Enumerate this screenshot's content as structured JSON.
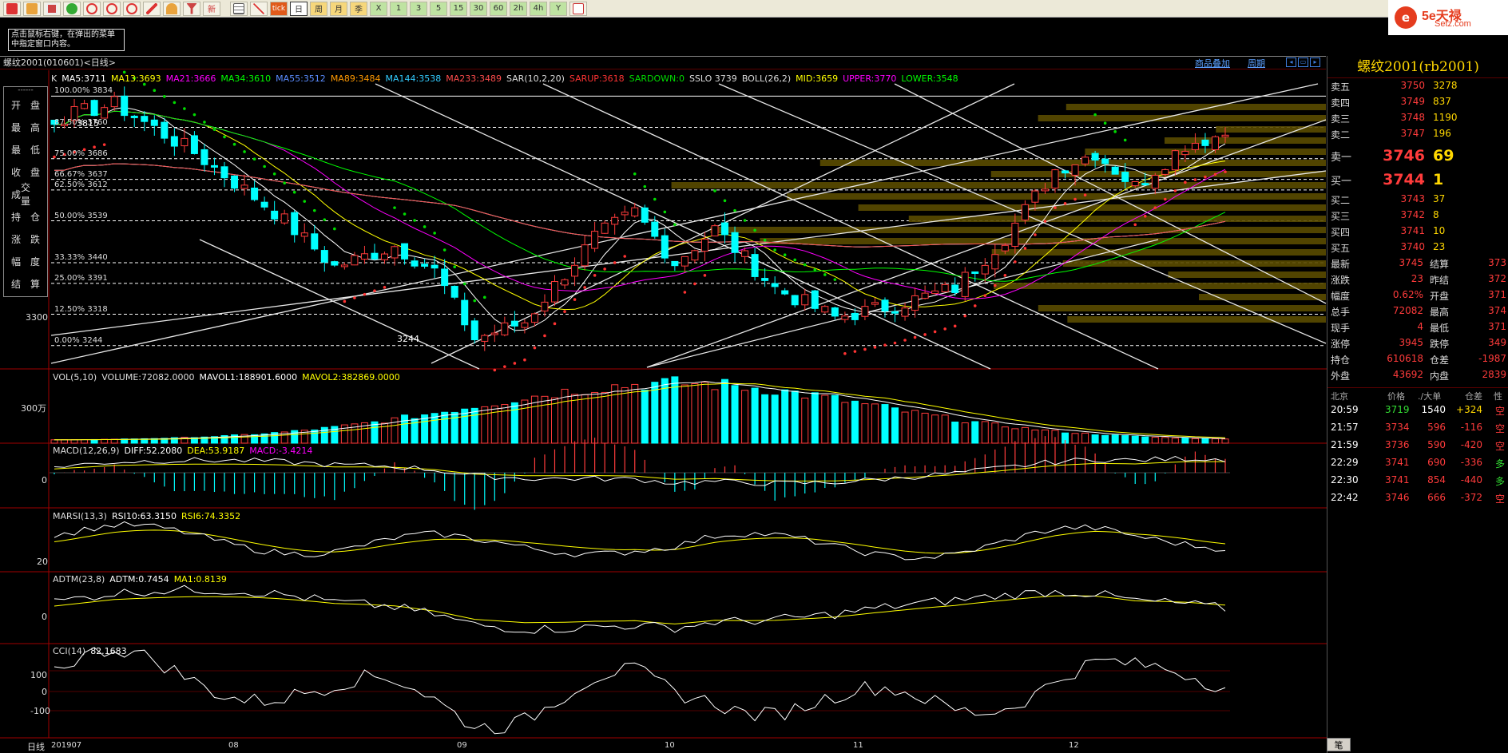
{
  "toolbar": {
    "icons": [
      "home-icon",
      "folder-icon",
      "monitor-icon",
      "refresh-icon",
      "zoom-in-icon",
      "zoom-out-icon",
      "zoom-icon",
      "pencil-icon",
      "gauge-icon",
      "filter-icon",
      "new-icon",
      "table-icon",
      "line-chart-icon",
      "tick-icon"
    ],
    "tick_label": "tick",
    "new_label": "新",
    "periods": [
      "日",
      "周",
      "月",
      "季",
      "X",
      "1",
      "3",
      "5",
      "15",
      "30",
      "60",
      "2h",
      "4h",
      "Y"
    ],
    "selected_period": "日",
    "trailing_icon": "calendar-icon"
  },
  "logo": {
    "brand": "5e天禄",
    "domain": "Setz.com",
    "mark": "e"
  },
  "hint": {
    "text": "点击鼠标右键，在弹出的菜单中指定窗口内容。"
  },
  "title_bar": {
    "label": "螺纹2001(010601)<日线>",
    "overlay_link": "商品叠加",
    "cycle_link": "周期"
  },
  "left_menu": {
    "dash": "------",
    "items": [
      [
        "开",
        "盘"
      ],
      [
        "最",
        "高"
      ],
      [
        "最",
        "低"
      ],
      [
        "收",
        "盘"
      ],
      [
        "成",
        "交量"
      ],
      [
        "持",
        "仓"
      ],
      [
        "涨",
        "跌"
      ],
      [
        "幅",
        "度"
      ],
      [
        "结",
        "算"
      ]
    ]
  },
  "main_panel": {
    "letter": "K",
    "indicators": [
      {
        "text": "MA5:3711",
        "color": "#ffffff"
      },
      {
        "text": "MA13:3693",
        "color": "#ffff00"
      },
      {
        "text": "MA21:3666",
        "color": "#ff00ff"
      },
      {
        "text": "MA34:3610",
        "color": "#00ff00"
      },
      {
        "text": "MA55:3512",
        "color": "#5a8cff"
      },
      {
        "text": "MA89:3484",
        "color": "#ff9900"
      },
      {
        "text": "MA144:3538",
        "color": "#33ccff"
      },
      {
        "text": "MA233:3489",
        "color": "#ff4d4d"
      },
      {
        "text": "SAR(10,2,20)",
        "color": "#dddddd"
      },
      {
        "text": "SARUP:3618",
        "color": "#ff3333"
      },
      {
        "text": "SARDOWN:0",
        "color": "#00dd00"
      },
      {
        "text": "SSLO 3739",
        "color": "#dddddd"
      },
      {
        "text": "BOLL(26,2)",
        "color": "#dddddd"
      },
      {
        "text": "MID:3659",
        "color": "#ffff00"
      },
      {
        "text": "UPPER:3770",
        "color": "#ff00ff"
      },
      {
        "text": "LOWER:3548",
        "color": "#00ff00"
      }
    ],
    "fib_levels": [
      {
        "label": "100.00%",
        "value": "3834"
      },
      {
        "label": "87.50%",
        "value": "3760"
      },
      {
        "label": "75.00%",
        "value": "3686"
      },
      {
        "label": "66.67%",
        "value": "3637"
      },
      {
        "label": "62.50%",
        "value": "3612"
      },
      {
        "label": "50.00%",
        "value": "3539"
      },
      {
        "label": "33.33%",
        "value": "3440"
      },
      {
        "label": "25.00%",
        "value": "3391"
      },
      {
        "label": "12.50%",
        "value": "3318"
      },
      {
        "label": "0.00%",
        "value": "3244"
      }
    ],
    "high_mark": "3815",
    "low_mark": "3244",
    "y_label": "3300"
  },
  "vol_panel": {
    "indicators": [
      {
        "text": "VOL(5,10)",
        "color": "#dddddd"
      },
      {
        "text": "VOLUME:72082.0000",
        "color": "#dddddd"
      },
      {
        "text": "MAVOL1:188901.6000",
        "color": "#ffffff"
      },
      {
        "text": "MAVOL2:382869.0000",
        "color": "#ffff00"
      }
    ],
    "y_label": "300万"
  },
  "macd_panel": {
    "indicators": [
      {
        "text": "MACD(12,26,9)",
        "color": "#dddddd"
      },
      {
        "text": "DIFF:52.2080",
        "color": "#ffffff"
      },
      {
        "text": "DEA:53.9187",
        "color": "#ffff00"
      },
      {
        "text": "MACD:-3.4214",
        "color": "#ff00ff"
      }
    ],
    "y_label": "0"
  },
  "rsi_panel": {
    "indicators": [
      {
        "text": "MARSI(13,3)",
        "color": "#dddddd"
      },
      {
        "text": "RSI10:63.3150",
        "color": "#ffffff"
      },
      {
        "text": "RSI6:74.3352",
        "color": "#ffff00"
      }
    ],
    "y_label": "20"
  },
  "adtm_panel": {
    "indicators": [
      {
        "text": "ADTM(23,8)",
        "color": "#dddddd"
      },
      {
        "text": "ADTM:0.7454",
        "color": "#ffffff"
      },
      {
        "text": "MA1:0.8139",
        "color": "#ffff00"
      }
    ],
    "y_label": "0"
  },
  "cci_panel": {
    "indicators": [
      {
        "text": "CCI(14)",
        "color": "#dddddd"
      },
      {
        "text": "82.1683",
        "color": "#ffffff"
      }
    ],
    "y_labels": [
      "100",
      "0",
      "-100"
    ]
  },
  "x_axis": {
    "period_label": "日线",
    "labels": [
      "201907",
      "08",
      "09",
      "10",
      "11",
      "12"
    ]
  },
  "quote": {
    "title": "螺纹2001(rb2001)",
    "asks": [
      {
        "label": "卖五",
        "price": "3750",
        "vol": "3278"
      },
      {
        "label": "卖四",
        "price": "3749",
        "vol": "837"
      },
      {
        "label": "卖三",
        "price": "3748",
        "vol": "1190"
      },
      {
        "label": "卖二",
        "price": "3747",
        "vol": "196"
      },
      {
        "label": "卖一",
        "price": "3746",
        "vol": "69"
      }
    ],
    "bids": [
      {
        "label": "买一",
        "price": "3744",
        "vol": "1"
      },
      {
        "label": "买二",
        "price": "3743",
        "vol": "37"
      },
      {
        "label": "买三",
        "price": "3742",
        "vol": "8"
      },
      {
        "label": "买四",
        "price": "3741",
        "vol": "10"
      },
      {
        "label": "买五",
        "price": "3740",
        "vol": "23"
      }
    ],
    "stats": [
      {
        "l1": "最新",
        "v1": "3745",
        "l2": "结算",
        "v2": "373"
      },
      {
        "l1": "涨跌",
        "v1": "23",
        "l2": "昨结",
        "v2": "372"
      },
      {
        "l1": "幅度",
        "v1": "0.62%",
        "l2": "开盘",
        "v2": "371"
      },
      {
        "l1": "总手",
        "v1": "72082",
        "l2": "最高",
        "v2": "374"
      },
      {
        "l1": "现手",
        "v1": "4",
        "l2": "最低",
        "v2": "371"
      },
      {
        "l1": "涨停",
        "v1": "3945",
        "l2": "跌停",
        "v2": "349"
      },
      {
        "l1": "持仓",
        "v1": "610618",
        "l2": "仓差",
        "v2": "-1987"
      },
      {
        "l1": "外盘",
        "v1": "43692",
        "l2": "内盘",
        "v2": "2839"
      }
    ],
    "tick_headers": [
      "北京",
      "价格",
      "./大单",
      "仓差",
      "性"
    ],
    "ticks": [
      {
        "time": "20:59",
        "price": "3719",
        "vol": "1540",
        "oi": "+324",
        "nature": "空"
      },
      {
        "time": "21:57",
        "price": "3734",
        "vol": "596",
        "oi": "-116",
        "nature": "空"
      },
      {
        "time": "21:59",
        "price": "3736",
        "vol": "590",
        "oi": "-420",
        "nature": "空"
      },
      {
        "time": "22:29",
        "price": "3741",
        "vol": "690",
        "oi": "-336",
        "nature": "多"
      },
      {
        "time": "22:30",
        "price": "3741",
        "vol": "854",
        "oi": "-440",
        "nature": "多"
      },
      {
        "time": "22:42",
        "price": "3746",
        "vol": "666",
        "oi": "-372",
        "nature": "空"
      }
    ],
    "bottom_tab": "笔"
  }
}
